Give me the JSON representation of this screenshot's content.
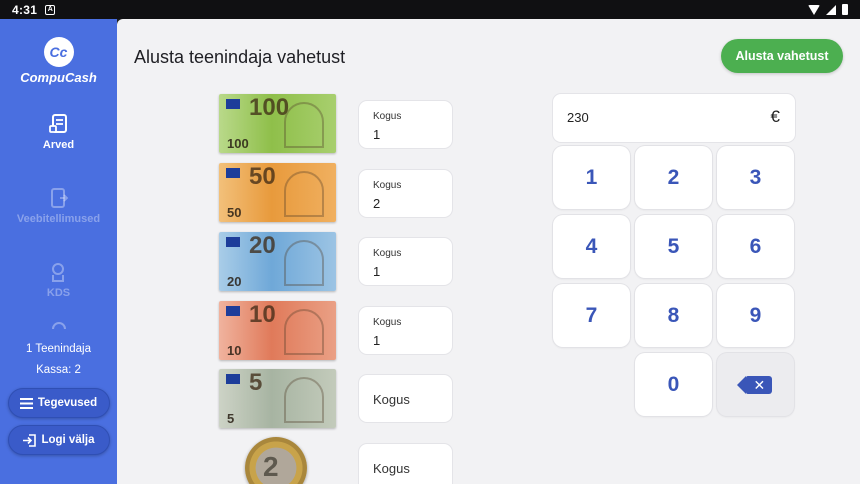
{
  "status_bar": {
    "time": "4:31",
    "notification": "A"
  },
  "sidebar": {
    "logo_mark": "Cc",
    "logo_text": "CompuCash",
    "nav": [
      {
        "label": "Arved",
        "icon": "receipt-icon",
        "enabled": true
      },
      {
        "label": "Veebitellimused",
        "icon": "web-order-icon",
        "enabled": false
      },
      {
        "label": "KDS",
        "icon": "chef-icon",
        "enabled": false
      }
    ],
    "user_info": "1 Teenindaja",
    "register_info": "Kassa: 2",
    "actions_button": "Tegevused",
    "logout_button": "Logi välja"
  },
  "header": {
    "title": "Alusta teenindaja vahetust",
    "start_button": "Alusta vahetust"
  },
  "denominations": [
    {
      "name": "100",
      "value": "100",
      "quantity_label": "Kogus",
      "quantity": "1",
      "color": "#8fbf4a"
    },
    {
      "name": "50",
      "value": "50",
      "quantity_label": "Kogus",
      "quantity": "2",
      "color": "#e89a3c"
    },
    {
      "name": "20",
      "value": "20",
      "quantity_label": "Kogus",
      "quantity": "1",
      "color": "#6fa8d8"
    },
    {
      "name": "10",
      "value": "10",
      "quantity_label": "Kogus",
      "quantity": "1",
      "color": "#e07a5a"
    },
    {
      "name": "5",
      "value": "5",
      "quantity_label": "Kogus",
      "quantity": "",
      "color": "#a7b4a2"
    },
    {
      "name": "2",
      "value": "2",
      "quantity_label": "Kogus",
      "quantity": "",
      "color": "#c8a34a"
    }
  ],
  "amount": {
    "value": "230",
    "currency": "€"
  },
  "keypad": [
    "1",
    "2",
    "3",
    "4",
    "5",
    "6",
    "7",
    "8",
    "9",
    "0"
  ]
}
